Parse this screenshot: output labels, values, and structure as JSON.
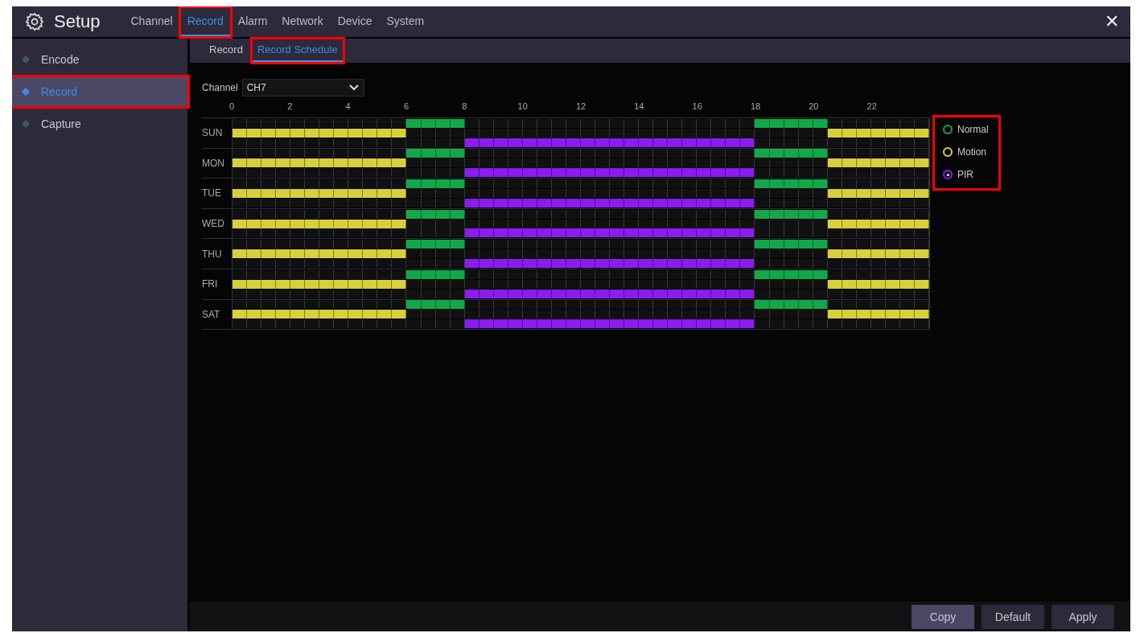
{
  "header": {
    "title": "Setup",
    "tabs": [
      {
        "label": "Channel",
        "selected": false,
        "highlighted": false
      },
      {
        "label": "Record",
        "selected": true,
        "highlighted": true
      },
      {
        "label": "Alarm",
        "selected": false,
        "highlighted": false
      },
      {
        "label": "Network",
        "selected": false,
        "highlighted": false
      },
      {
        "label": "Device",
        "selected": false,
        "highlighted": false
      },
      {
        "label": "System",
        "selected": false,
        "highlighted": false
      }
    ],
    "close": "✕"
  },
  "sidebar": {
    "items": [
      {
        "label": "Encode",
        "selected": false,
        "highlighted": false
      },
      {
        "label": "Record",
        "selected": true,
        "highlighted": true
      },
      {
        "label": "Capture",
        "selected": false,
        "highlighted": false
      }
    ]
  },
  "subtabs": [
    {
      "label": "Record",
      "selected": false,
      "highlighted": false
    },
    {
      "label": "Record Schedule",
      "selected": true,
      "highlighted": true
    }
  ],
  "channel": {
    "label": "Channel",
    "value": "CH7"
  },
  "schedule": {
    "hour_labels": [
      "0",
      "2",
      "4",
      "6",
      "8",
      "10",
      "12",
      "14",
      "16",
      "18",
      "20",
      "22"
    ],
    "days": [
      {
        "label": "SUN",
        "lanes": [
          {
            "kind": "normal",
            "slots": [
              false,
              false,
              false,
              false,
              false,
              false,
              false,
              false,
              false,
              false,
              false,
              false,
              true,
              true,
              true,
              true,
              false,
              false,
              false,
              false,
              false,
              false,
              false,
              false,
              false,
              false,
              false,
              false,
              false,
              false,
              false,
              false,
              false,
              false,
              false,
              false,
              true,
              true,
              true,
              true,
              true,
              false,
              false,
              false,
              false,
              false,
              false,
              false
            ]
          },
          {
            "kind": "motion",
            "slots": [
              true,
              true,
              true,
              true,
              true,
              true,
              true,
              true,
              true,
              true,
              true,
              true,
              false,
              false,
              false,
              false,
              false,
              false,
              false,
              false,
              false,
              false,
              false,
              false,
              false,
              false,
              false,
              false,
              false,
              false,
              false,
              false,
              false,
              false,
              false,
              false,
              false,
              false,
              false,
              false,
              false,
              true,
              true,
              true,
              true,
              true,
              true,
              true
            ]
          },
          {
            "kind": "pir",
            "slots": [
              false,
              false,
              false,
              false,
              false,
              false,
              false,
              false,
              false,
              false,
              false,
              false,
              false,
              false,
              false,
              false,
              true,
              true,
              true,
              true,
              true,
              true,
              true,
              true,
              true,
              true,
              true,
              true,
              true,
              true,
              true,
              true,
              true,
              true,
              true,
              true,
              false,
              false,
              false,
              false,
              false,
              false,
              false,
              false,
              false,
              false,
              false,
              false
            ]
          }
        ]
      },
      {
        "label": "MON",
        "lanes": [
          {
            "kind": "normal",
            "slots": [
              false,
              false,
              false,
              false,
              false,
              false,
              false,
              false,
              false,
              false,
              false,
              false,
              true,
              true,
              true,
              true,
              false,
              false,
              false,
              false,
              false,
              false,
              false,
              false,
              false,
              false,
              false,
              false,
              false,
              false,
              false,
              false,
              false,
              false,
              false,
              false,
              true,
              true,
              true,
              true,
              true,
              false,
              false,
              false,
              false,
              false,
              false,
              false
            ]
          },
          {
            "kind": "motion",
            "slots": [
              true,
              true,
              true,
              true,
              true,
              true,
              true,
              true,
              true,
              true,
              true,
              true,
              false,
              false,
              false,
              false,
              false,
              false,
              false,
              false,
              false,
              false,
              false,
              false,
              false,
              false,
              false,
              false,
              false,
              false,
              false,
              false,
              false,
              false,
              false,
              false,
              false,
              false,
              false,
              false,
              false,
              true,
              true,
              true,
              true,
              true,
              true,
              true
            ]
          },
          {
            "kind": "pir",
            "slots": [
              false,
              false,
              false,
              false,
              false,
              false,
              false,
              false,
              false,
              false,
              false,
              false,
              false,
              false,
              false,
              false,
              true,
              true,
              true,
              true,
              true,
              true,
              true,
              true,
              true,
              true,
              true,
              true,
              true,
              true,
              true,
              true,
              true,
              true,
              true,
              true,
              false,
              false,
              false,
              false,
              false,
              false,
              false,
              false,
              false,
              false,
              false,
              false
            ]
          }
        ]
      },
      {
        "label": "TUE",
        "lanes": [
          {
            "kind": "normal",
            "slots": [
              false,
              false,
              false,
              false,
              false,
              false,
              false,
              false,
              false,
              false,
              false,
              false,
              true,
              true,
              true,
              true,
              false,
              false,
              false,
              false,
              false,
              false,
              false,
              false,
              false,
              false,
              false,
              false,
              false,
              false,
              false,
              false,
              false,
              false,
              false,
              false,
              true,
              true,
              true,
              true,
              true,
              false,
              false,
              false,
              false,
              false,
              false,
              false
            ]
          },
          {
            "kind": "motion",
            "slots": [
              true,
              true,
              true,
              true,
              true,
              true,
              true,
              true,
              true,
              true,
              true,
              true,
              false,
              false,
              false,
              false,
              false,
              false,
              false,
              false,
              false,
              false,
              false,
              false,
              false,
              false,
              false,
              false,
              false,
              false,
              false,
              false,
              false,
              false,
              false,
              false,
              false,
              false,
              false,
              false,
              false,
              true,
              true,
              true,
              true,
              true,
              true,
              true
            ]
          },
          {
            "kind": "pir",
            "slots": [
              false,
              false,
              false,
              false,
              false,
              false,
              false,
              false,
              false,
              false,
              false,
              false,
              false,
              false,
              false,
              false,
              true,
              true,
              true,
              true,
              true,
              true,
              true,
              true,
              true,
              true,
              true,
              true,
              true,
              true,
              true,
              true,
              true,
              true,
              true,
              true,
              false,
              false,
              false,
              false,
              false,
              false,
              false,
              false,
              false,
              false,
              false,
              false
            ]
          }
        ]
      },
      {
        "label": "WED",
        "lanes": [
          {
            "kind": "normal",
            "slots": [
              false,
              false,
              false,
              false,
              false,
              false,
              false,
              false,
              false,
              false,
              false,
              false,
              true,
              true,
              true,
              true,
              false,
              false,
              false,
              false,
              false,
              false,
              false,
              false,
              false,
              false,
              false,
              false,
              false,
              false,
              false,
              false,
              false,
              false,
              false,
              false,
              true,
              true,
              true,
              true,
              true,
              false,
              false,
              false,
              false,
              false,
              false,
              false
            ]
          },
          {
            "kind": "motion",
            "slots": [
              true,
              true,
              true,
              true,
              true,
              true,
              true,
              true,
              true,
              true,
              true,
              true,
              false,
              false,
              false,
              false,
              false,
              false,
              false,
              false,
              false,
              false,
              false,
              false,
              false,
              false,
              false,
              false,
              false,
              false,
              false,
              false,
              false,
              false,
              false,
              false,
              false,
              false,
              false,
              false,
              false,
              true,
              true,
              true,
              true,
              true,
              true,
              true
            ]
          },
          {
            "kind": "pir",
            "slots": [
              false,
              false,
              false,
              false,
              false,
              false,
              false,
              false,
              false,
              false,
              false,
              false,
              false,
              false,
              false,
              false,
              true,
              true,
              true,
              true,
              true,
              true,
              true,
              true,
              true,
              true,
              true,
              true,
              true,
              true,
              true,
              true,
              true,
              true,
              true,
              true,
              false,
              false,
              false,
              false,
              false,
              false,
              false,
              false,
              false,
              false,
              false,
              false
            ]
          }
        ]
      },
      {
        "label": "THU",
        "lanes": [
          {
            "kind": "normal",
            "slots": [
              false,
              false,
              false,
              false,
              false,
              false,
              false,
              false,
              false,
              false,
              false,
              false,
              true,
              true,
              true,
              true,
              false,
              false,
              false,
              false,
              false,
              false,
              false,
              false,
              false,
              false,
              false,
              false,
              false,
              false,
              false,
              false,
              false,
              false,
              false,
              false,
              true,
              true,
              true,
              true,
              true,
              false,
              false,
              false,
              false,
              false,
              false,
              false
            ]
          },
          {
            "kind": "motion",
            "slots": [
              true,
              true,
              true,
              true,
              true,
              true,
              true,
              true,
              true,
              true,
              true,
              true,
              false,
              false,
              false,
              false,
              false,
              false,
              false,
              false,
              false,
              false,
              false,
              false,
              false,
              false,
              false,
              false,
              false,
              false,
              false,
              false,
              false,
              false,
              false,
              false,
              false,
              false,
              false,
              false,
              false,
              true,
              true,
              true,
              true,
              true,
              true,
              true
            ]
          },
          {
            "kind": "pir",
            "slots": [
              false,
              false,
              false,
              false,
              false,
              false,
              false,
              false,
              false,
              false,
              false,
              false,
              false,
              false,
              false,
              false,
              true,
              true,
              true,
              true,
              true,
              true,
              true,
              true,
              true,
              true,
              true,
              true,
              true,
              true,
              true,
              true,
              true,
              true,
              true,
              true,
              false,
              false,
              false,
              false,
              false,
              false,
              false,
              false,
              false,
              false,
              false,
              false
            ]
          }
        ]
      },
      {
        "label": "FRI",
        "lanes": [
          {
            "kind": "normal",
            "slots": [
              false,
              false,
              false,
              false,
              false,
              false,
              false,
              false,
              false,
              false,
              false,
              false,
              true,
              true,
              true,
              true,
              false,
              false,
              false,
              false,
              false,
              false,
              false,
              false,
              false,
              false,
              false,
              false,
              false,
              false,
              false,
              false,
              false,
              false,
              false,
              false,
              true,
              true,
              true,
              true,
              true,
              false,
              false,
              false,
              false,
              false,
              false,
              false
            ]
          },
          {
            "kind": "motion",
            "slots": [
              true,
              true,
              true,
              true,
              true,
              true,
              true,
              true,
              true,
              true,
              true,
              true,
              false,
              false,
              false,
              false,
              false,
              false,
              false,
              false,
              false,
              false,
              false,
              false,
              false,
              false,
              false,
              false,
              false,
              false,
              false,
              false,
              false,
              false,
              false,
              false,
              false,
              false,
              false,
              false,
              false,
              true,
              true,
              true,
              true,
              true,
              true,
              true
            ]
          },
          {
            "kind": "pir",
            "slots": [
              false,
              false,
              false,
              false,
              false,
              false,
              false,
              false,
              false,
              false,
              false,
              false,
              false,
              false,
              false,
              false,
              true,
              true,
              true,
              true,
              true,
              true,
              true,
              true,
              true,
              true,
              true,
              true,
              true,
              true,
              true,
              true,
              true,
              true,
              true,
              true,
              false,
              false,
              false,
              false,
              false,
              false,
              false,
              false,
              false,
              false,
              false,
              false
            ]
          }
        ]
      },
      {
        "label": "SAT",
        "lanes": [
          {
            "kind": "normal",
            "slots": [
              false,
              false,
              false,
              false,
              false,
              false,
              false,
              false,
              false,
              false,
              false,
              false,
              true,
              true,
              true,
              true,
              false,
              false,
              false,
              false,
              false,
              false,
              false,
              false,
              false,
              false,
              false,
              false,
              false,
              false,
              false,
              false,
              false,
              false,
              false,
              false,
              true,
              true,
              true,
              true,
              true,
              false,
              false,
              false,
              false,
              false,
              false,
              false
            ]
          },
          {
            "kind": "motion",
            "slots": [
              true,
              true,
              true,
              true,
              true,
              true,
              true,
              true,
              true,
              true,
              true,
              true,
              false,
              false,
              false,
              false,
              false,
              false,
              false,
              false,
              false,
              false,
              false,
              false,
              false,
              false,
              false,
              false,
              false,
              false,
              false,
              false,
              false,
              false,
              false,
              false,
              false,
              false,
              false,
              false,
              false,
              true,
              true,
              true,
              true,
              true,
              true,
              true
            ]
          },
          {
            "kind": "pir",
            "slots": [
              false,
              false,
              false,
              false,
              false,
              false,
              false,
              false,
              false,
              false,
              false,
              false,
              false,
              false,
              false,
              false,
              true,
              true,
              true,
              true,
              true,
              true,
              true,
              true,
              true,
              true,
              true,
              true,
              true,
              true,
              true,
              true,
              true,
              true,
              true,
              true,
              false,
              false,
              false,
              false,
              false,
              false,
              false,
              false,
              false,
              false,
              false,
              false
            ]
          }
        ]
      }
    ]
  },
  "legend": {
    "highlighted": true,
    "items": [
      {
        "label": "Normal",
        "kind": "normal",
        "color": "#12a84a",
        "selected": false
      },
      {
        "label": "Motion",
        "kind": "motion",
        "color": "#d8d03a",
        "selected": false
      },
      {
        "label": "PIR",
        "kind": "pir",
        "color": "#8a1cf0",
        "selected": true
      }
    ]
  },
  "buttons": [
    {
      "label": "Copy",
      "selected": true
    },
    {
      "label": "Default",
      "selected": false
    },
    {
      "label": "Apply",
      "selected": false
    }
  ]
}
